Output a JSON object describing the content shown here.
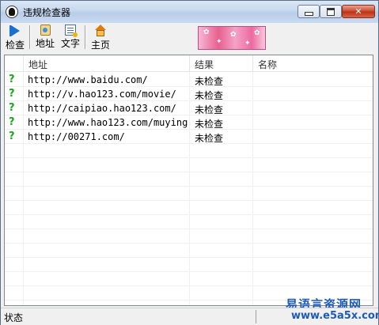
{
  "window": {
    "title": "违规检查器"
  },
  "toolbar": {
    "items": [
      {
        "label": "检查",
        "icon": "play-icon"
      },
      {
        "label": "地址",
        "icon": "address-book-icon"
      },
      {
        "label": "文字",
        "icon": "text-document-icon"
      },
      {
        "label": "主页",
        "icon": "home-icon"
      }
    ]
  },
  "list": {
    "columns": [
      "地址",
      "结果",
      "名称"
    ],
    "rows": [
      {
        "icon": "question-mark-icon",
        "address": "http://www.baidu.com/",
        "result": "未检查",
        "name": ""
      },
      {
        "icon": "question-mark-icon",
        "address": "http://v.hao123.com/movie/",
        "result": "未检查",
        "name": ""
      },
      {
        "icon": "question-mark-icon",
        "address": "http://caipiao.hao123.com/",
        "result": "未检查",
        "name": ""
      },
      {
        "icon": "question-mark-icon",
        "address": "http://www.hao123.com/muying",
        "result": "未检查",
        "name": ""
      },
      {
        "icon": "question-mark-icon",
        "address": "http://00271.com/",
        "result": "未检查",
        "name": ""
      }
    ]
  },
  "status": {
    "text": "状态"
  },
  "watermark": {
    "line1": "易语言资源网",
    "line2": "www.e5a5x.com"
  },
  "colors": {
    "accent": "#1a6fd0",
    "status_ok": "#1aa51a",
    "watermark": "#1e5bb8"
  }
}
